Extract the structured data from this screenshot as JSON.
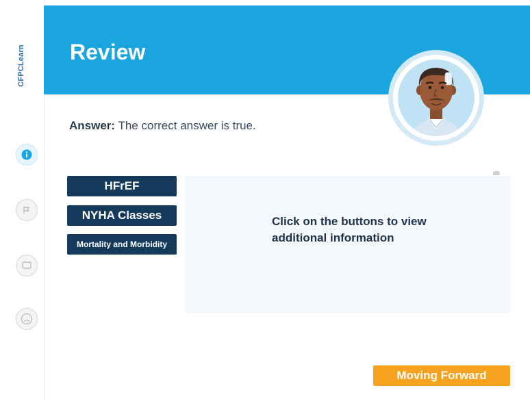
{
  "brand": {
    "logo_text": "CFPCLearn"
  },
  "sidebar": {
    "icons": [
      {
        "name": "info-icon",
        "active": true
      },
      {
        "name": "flag-icon",
        "active": false
      },
      {
        "name": "chat-icon",
        "active": false
      },
      {
        "name": "profile-icon",
        "active": false
      }
    ]
  },
  "header": {
    "title": "Review",
    "background_color": "#1aa5de"
  },
  "answer": {
    "label": "Answer:",
    "text": "The correct answer is true."
  },
  "topics": [
    {
      "label": "HFrEF"
    },
    {
      "label": "NYHA Classes"
    },
    {
      "label": "Mortality and Morbidity"
    }
  ],
  "panel": {
    "text": "Click on the buttons to view additional information"
  },
  "forward_button": {
    "label": "Moving Forward",
    "color": "#f6a21e"
  }
}
